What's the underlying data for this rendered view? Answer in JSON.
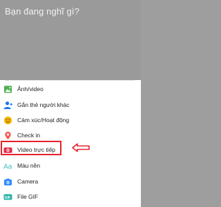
{
  "composer": {
    "placeholder": "Bạn đang nghĩ gì?"
  },
  "menu": {
    "items": [
      {
        "label": "Ảnh/video",
        "icon": "photo-icon",
        "color": "#4caf50"
      },
      {
        "label": "Gắn thẻ người khác",
        "icon": "tag-people-icon",
        "color": "#1877f2"
      },
      {
        "label": "Cảm xúc/Hoạt động",
        "icon": "emoji-icon",
        "color": "#f5b400"
      },
      {
        "label": "Check in",
        "icon": "location-pin-icon",
        "color": "#f25c54"
      },
      {
        "label": "Video trực tiếp",
        "icon": "live-video-icon",
        "color": "#e42645"
      },
      {
        "label": "Màu nền",
        "icon": "text-background-icon",
        "color": "#44bec7"
      },
      {
        "label": "Camera",
        "icon": "camera-icon",
        "color": "#2d88ff"
      },
      {
        "label": "File GIF",
        "icon": "gif-icon",
        "color": "#29b3a6"
      }
    ]
  },
  "annotation": {
    "color": "#e5202a"
  }
}
